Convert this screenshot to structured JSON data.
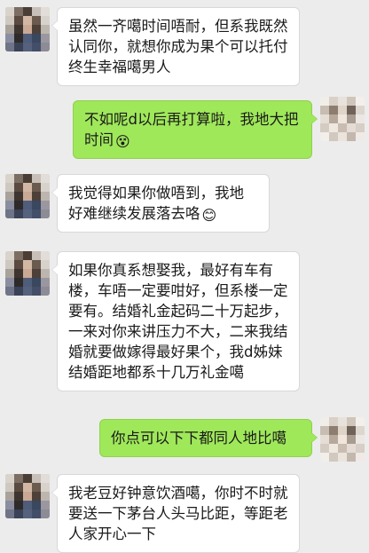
{
  "messages": [
    {
      "side": "in",
      "text": "虽然一齐噶时间唔耐，但系我既然认同你，就想你成为果个可以托付终生幸福噶男人",
      "emoji": ""
    },
    {
      "side": "out",
      "text": "不如呢d以后再打算啦，我地大把时间",
      "emoji": "😵"
    },
    {
      "side": "in",
      "text": "我觉得如果你做唔到，我地好难继续发展落去咯",
      "emoji": "😊"
    },
    {
      "side": "in",
      "text": "如果你真系想娶我，最好有车有楼，车唔一定要咁好，但系楼一定要有。结婚礼金起码二十万起步，一来对你来讲压力不大，二来我结婚就要做嫁得最好果个，我d姊妹结婚距地都系十几万礼金噶",
      "emoji": ""
    },
    {
      "side": "out",
      "text": "你点可以下下都同人地比噶",
      "emoji": ""
    },
    {
      "side": "in",
      "text": "我老豆好钟意饮酒噶，你时不时就要送一下茅台人头马比距，等距老人家开心一下",
      "emoji": ""
    }
  ],
  "colors": {
    "background": "#ececec",
    "incoming_bubble": "#ffffff",
    "outgoing_bubble": "#9fe85a"
  },
  "icons": {
    "left_avatar": "blurred-contact-avatar",
    "right_avatar": "blurred-self-avatar"
  }
}
